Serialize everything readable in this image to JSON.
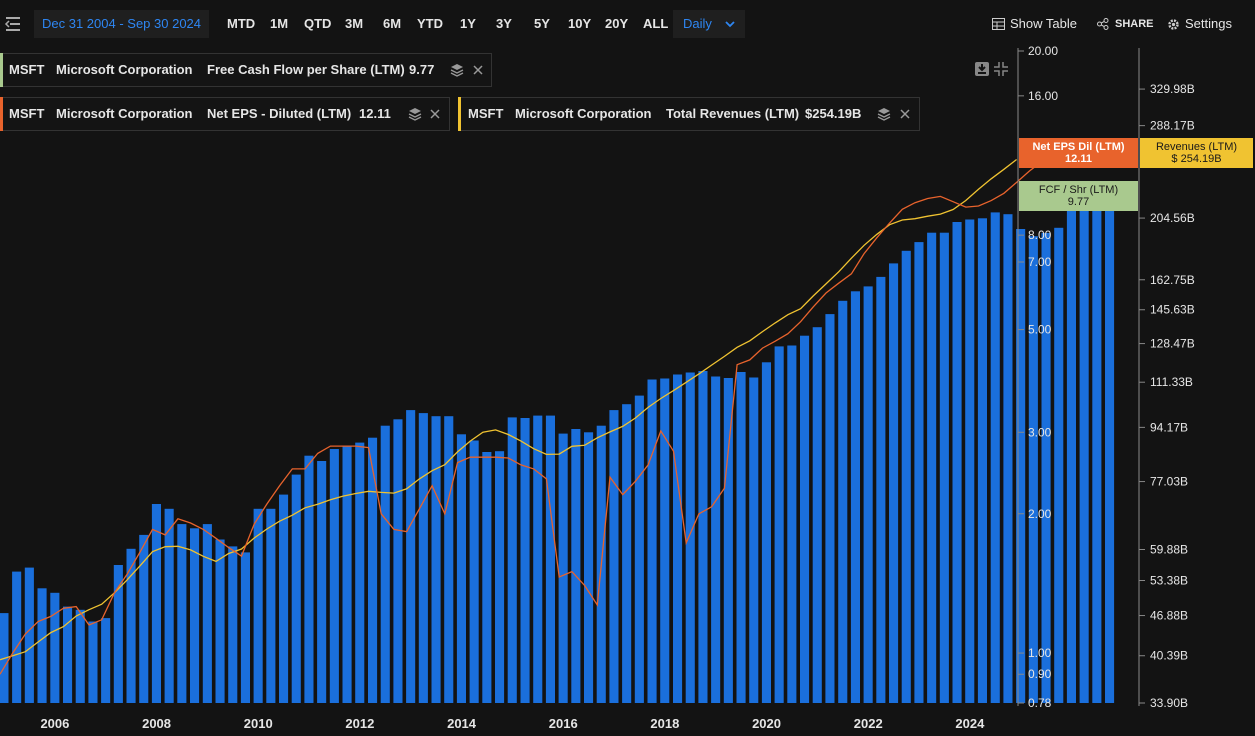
{
  "toolbar": {
    "date_range": "Dec 31 2004 - Sep 30 2024",
    "ranges": [
      "MTD",
      "1M",
      "QTD",
      "3M",
      "6M",
      "YTD",
      "1Y",
      "3Y",
      "5Y",
      "10Y",
      "20Y",
      "ALL"
    ],
    "frequency": "Daily",
    "show_table": "Show Table",
    "share": "SHARE",
    "settings": "Settings"
  },
  "legends": [
    {
      "ticker": "MSFT",
      "company": "Microsoft Corporation",
      "metric": "Free Cash Flow per Share (LTM)",
      "value": "9.77",
      "color": "#a9c98e"
    },
    {
      "ticker": "MSFT",
      "company": "Microsoft Corporation",
      "metric": "Net EPS - Diluted (LTM)",
      "value": "12.11",
      "color": "#e8632c"
    },
    {
      "ticker": "MSFT",
      "company": "Microsoft Corporation",
      "metric": "Total Revenues (LTM)",
      "value": "$254.19B",
      "color": "#f0c331"
    }
  ],
  "badges": {
    "eps": {
      "line1": "Net EPS Dil (LTM)",
      "line2": "12.11",
      "color": "#e8632c"
    },
    "revenue": {
      "line1": "Revenues (LTM)",
      "line2": "$ 254.19B",
      "color": "#f0c331"
    },
    "fcf": {
      "line1": "FCF / Shr (LTM)",
      "line2": "9.77",
      "color": "#a9c98e"
    }
  },
  "chart_data": {
    "type": "bar",
    "x_start": 2004.92,
    "x_end": 2024.75,
    "xticks": [
      "2006",
      "2008",
      "2010",
      "2012",
      "2014",
      "2016",
      "2018",
      "2020",
      "2022",
      "2024"
    ],
    "left_axis": {
      "scale": "log",
      "ticks": [
        "20.00",
        "16.00",
        "8.00",
        "7.00",
        "5.00",
        "3.00",
        "2.00",
        "1.00",
        "0.90",
        "0.78"
      ],
      "range": [
        0.78,
        20
      ]
    },
    "right_axis": {
      "scale": "log",
      "ticks": [
        "329.98B",
        "288.17B",
        "204.56B",
        "162.75B",
        "145.63B",
        "128.47B",
        "111.33B",
        "94.17B",
        "77.03B",
        "59.88B",
        "53.38B",
        "46.88B",
        "40.39B",
        "33.90B"
      ],
      "range": [
        33.9,
        380
      ]
    },
    "series": [
      {
        "name": "Free Cash Flow per Share (LTM)",
        "axis": "left",
        "type": "bar",
        "color": "#1a6fdc",
        "start": 2004.92,
        "step": 0.25,
        "values": [
          1.22,
          1.5,
          1.53,
          1.38,
          1.35,
          1.26,
          1.24,
          1.17,
          1.19,
          1.55,
          1.68,
          1.8,
          2.1,
          2.05,
          1.9,
          1.86,
          1.9,
          1.76,
          1.7,
          1.65,
          2.05,
          2.05,
          2.2,
          2.43,
          2.67,
          2.6,
          2.76,
          2.8,
          2.85,
          2.92,
          3.1,
          3.2,
          3.35,
          3.3,
          3.25,
          3.25,
          2.97,
          2.88,
          2.72,
          2.73,
          3.23,
          3.22,
          3.26,
          3.26,
          2.98,
          3.05,
          3.0,
          3.1,
          3.35,
          3.45,
          3.6,
          3.9,
          3.92,
          4.0,
          4.04,
          4.07,
          3.96,
          3.93,
          4.05,
          3.94,
          4.25,
          4.6,
          4.62,
          4.85,
          5.06,
          5.4,
          5.77,
          6.05,
          6.2,
          6.5,
          6.95,
          7.4,
          7.73,
          8.1,
          8.1,
          8.54,
          8.65,
          8.7,
          8.96,
          8.88,
          8.25,
          7.96,
          8.09,
          8.3,
          9.05,
          9.5,
          9.95,
          9.82
        ]
      },
      {
        "name": "Net EPS - Diluted (LTM)",
        "axis": "left",
        "type": "line",
        "color": "#e8632c",
        "start": 2004.92,
        "step": 0.25,
        "values": [
          0.9,
          1.0,
          1.1,
          1.17,
          1.2,
          1.25,
          1.26,
          1.15,
          1.18,
          1.35,
          1.48,
          1.65,
          1.85,
          1.8,
          1.95,
          1.91,
          1.85,
          1.77,
          1.69,
          1.62,
          1.9,
          2.1,
          2.3,
          2.5,
          2.5,
          2.7,
          2.8,
          2.8,
          2.8,
          2.78,
          2.0,
          1.85,
          1.83,
          2.05,
          2.3,
          2.0,
          2.58,
          2.65,
          2.65,
          2.65,
          2.64,
          2.55,
          2.5,
          2.38,
          1.46,
          1.5,
          1.4,
          1.27,
          2.4,
          2.2,
          2.35,
          2.55,
          3.02,
          2.73,
          1.73,
          2.0,
          2.07,
          2.27,
          4.2,
          4.3,
          4.56,
          4.72,
          4.9,
          5.2,
          5.6,
          6.0,
          6.3,
          6.6,
          7.3,
          7.9,
          8.5,
          9.1,
          9.4,
          9.6,
          9.7,
          9.45,
          9.2,
          9.25,
          9.5,
          9.85,
          10.4,
          11.0,
          11.55,
          11.85,
          12.11
        ]
      },
      {
        "name": "Total Revenues (LTM)",
        "axis": "right",
        "type": "line",
        "color": "#f0c331",
        "start": 2004.92,
        "step": 0.25,
        "values": [
          39.8,
          40.4,
          41.0,
          42.5,
          44.0,
          45.0,
          46.8,
          47.9,
          48.9,
          51.0,
          53.5,
          56.3,
          59.4,
          60.5,
          60.6,
          59.8,
          58.4,
          57.3,
          59.0,
          60.0,
          62.5,
          64.6,
          66.5,
          68.0,
          69.9,
          70.8,
          72.0,
          73.0,
          73.7,
          74.3,
          74.0,
          73.8,
          75.0,
          77.8,
          80.2,
          82.0,
          86.0,
          89.5,
          92.5,
          93.3,
          91.7,
          89.5,
          87.0,
          85.2,
          85.3,
          87.8,
          88.1,
          90.6,
          92.6,
          94.5,
          97.5,
          101.4,
          104.8,
          107.9,
          111.3,
          114.8,
          118.6,
          122.5,
          126.7,
          129.8,
          134.3,
          138.7,
          143.0,
          146.2,
          153.3,
          160.3,
          167.6,
          176.3,
          184.9,
          192.6,
          199.6,
          203.1,
          204.1,
          206.0,
          207.6,
          211.2,
          218.3,
          227.6,
          236.6,
          245.1,
          254.19
        ]
      }
    ]
  }
}
